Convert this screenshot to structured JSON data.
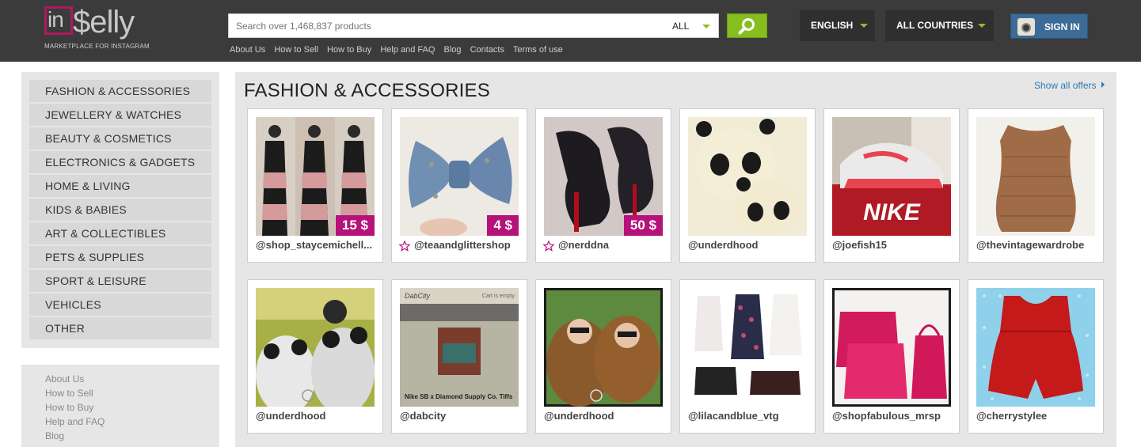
{
  "header": {
    "logo_in": "in",
    "logo_rest": "$elly",
    "tagline": "MARKETPLACE FOR INSTAGRAM",
    "search_placeholder": "Search over 1,468,837 products",
    "search_scope": "ALL",
    "language": "ENGLISH",
    "country": "ALL COUNTRIES",
    "signin": "SIGN IN",
    "links": [
      "About Us",
      "How to Sell",
      "How to Buy",
      "Help and FAQ",
      "Blog",
      "Contacts",
      "Terms of use"
    ]
  },
  "sidebar": {
    "categories": [
      "FASHION & ACCESSORIES",
      "JEWELLERY & WATCHES",
      "BEAUTY & COSMETICS",
      "ELECTRONICS & GADGETS",
      "HOME & LIVING",
      "KIDS & BABIES",
      "ART & COLLECTIBLES",
      "PETS & SUPPLIES",
      "SPORT & LEISURE",
      "VEHICLES",
      "OTHER"
    ],
    "links": [
      "About Us",
      "How to Sell",
      "How to Buy",
      "Help and FAQ",
      "Blog"
    ]
  },
  "main": {
    "title": "FASHION & ACCESSORIES",
    "show_all": "Show all offers",
    "products": [
      {
        "user": "@shop_staycemichell...",
        "price": "15 $",
        "star": false,
        "image": "black-pink-maxi-dresses"
      },
      {
        "user": "@teaandglittershop",
        "price": "4 $",
        "star": true,
        "image": "denim-hair-bow"
      },
      {
        "user": "@nerddna",
        "price": "50 $",
        "star": true,
        "image": "black-quilted-heels"
      },
      {
        "user": "@underdhood",
        "price": "",
        "star": false,
        "image": "panda-hoodie"
      },
      {
        "user": "@joefish15",
        "price": "",
        "star": false,
        "image": "nike-sneakers-box"
      },
      {
        "user": "@thevintagewardrobe",
        "price": "",
        "star": false,
        "image": "knit-vintage-top"
      },
      {
        "user": "@underdhood",
        "price": "",
        "star": false,
        "image": "couple-panda-hoodies"
      },
      {
        "user": "@dabcity",
        "price": "",
        "star": false,
        "image": "app-screenshot-sneakers"
      },
      {
        "user": "@underdhood",
        "price": "",
        "star": false,
        "image": "couple-bear-hoodies"
      },
      {
        "user": "@lilacandblue_vtg",
        "price": "",
        "star": false,
        "image": "vintage-dresses-shoes"
      },
      {
        "user": "@shopfabulous_mrsp",
        "price": "",
        "star": false,
        "image": "pink-handbags"
      },
      {
        "user": "@cherrystylee",
        "price": "",
        "star": false,
        "image": "red-romper"
      }
    ],
    "app_screenshot": {
      "brand": "DabCity",
      "cart": "Cart is empty",
      "caption": "Nike SB x Diamond Supply Co. Tiffs"
    }
  },
  "colors": {
    "header_bg": "#3b3b3b",
    "accent_green": "#86bd1f",
    "brand_magenta": "#b5137a",
    "link_blue": "#2a7bb8",
    "signin_blue": "#3b6b96"
  }
}
